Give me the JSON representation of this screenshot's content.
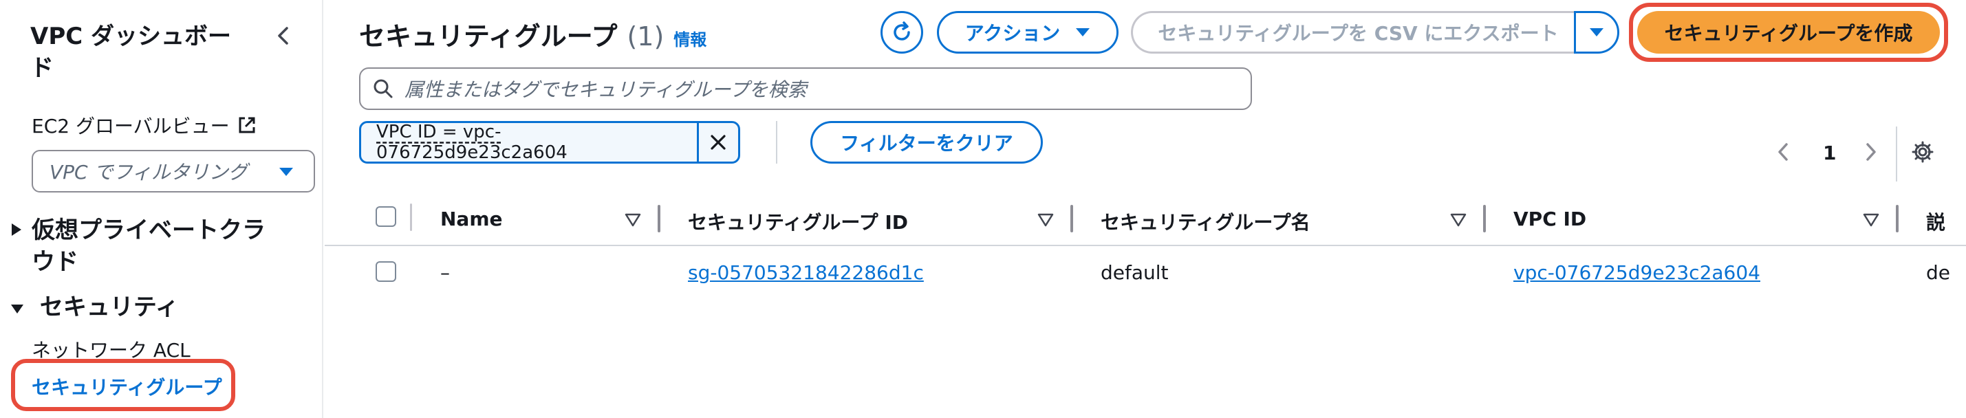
{
  "sidebar": {
    "title": "VPC ダッシュボード",
    "ec2_global_view": "EC2 グローバルビュー",
    "vpc_filter_placeholder": "VPC でフィルタリング",
    "sections": [
      {
        "label": "仮想プライベートクラウド",
        "expanded": false
      },
      {
        "label": "セキュリティ",
        "expanded": true,
        "items": [
          "ネットワーク ACL",
          "セキュリティグループ"
        ]
      }
    ]
  },
  "header": {
    "title": "セキュリティグループ",
    "count": "(1)",
    "info": "情報",
    "actions_label": "アクション",
    "export_label": "セキュリティグループを CSV にエクスポート",
    "create_label": "セキュリティグループを作成"
  },
  "search": {
    "placeholder": "属性またはタグでセキュリティグループを検索"
  },
  "filter": {
    "token": "VPC ID = vpc-076725d9e23c2a604",
    "clear_label": "フィルターをクリア"
  },
  "pagination": {
    "current_page": "1"
  },
  "table": {
    "columns": [
      "Name",
      "セキュリティグループ ID",
      "セキュリティグループ名",
      "VPC ID",
      "説"
    ],
    "rows": [
      {
        "name": "–",
        "sg_id": "sg-05705321842286d1c",
        "sg_name": "default",
        "vpc_id": "vpc-076725d9e23c2a604",
        "desc": "de"
      }
    ]
  },
  "colors": {
    "accent": "#0972d3",
    "primary_button": "#f5a03a",
    "highlight": "#e74c3c",
    "text": "#16191f",
    "muted": "#5f6b7a"
  },
  "icons": [
    "chevron-left-icon",
    "external-link-icon",
    "caret-down-icon",
    "refresh-icon",
    "search-icon",
    "close-icon",
    "chevron-right-icon",
    "gear-icon",
    "sort-icon"
  ]
}
